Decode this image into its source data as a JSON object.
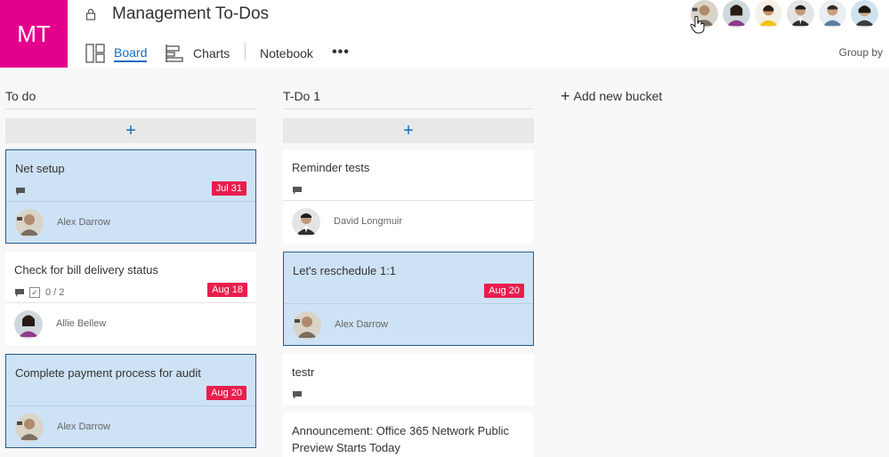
{
  "plan": {
    "initials": "MT",
    "logo_color": "#e3008c",
    "title": "Management To-Dos"
  },
  "nav": {
    "board": "Board",
    "charts": "Charts",
    "notebook": "Notebook",
    "more": "•••",
    "group_by": "Group by"
  },
  "members": [
    {
      "icon": "avatar-alex-darrow"
    },
    {
      "icon": "avatar-allie-bellew"
    },
    {
      "icon": "avatar-member-3"
    },
    {
      "icon": "avatar-david-longmuir"
    },
    {
      "icon": "avatar-member-5"
    },
    {
      "icon": "avatar-member-6"
    }
  ],
  "buckets": [
    {
      "name": "To do",
      "add_label": "+",
      "cards": [
        {
          "title": "Net setup",
          "due": "Jul 31",
          "assignee": "Alex Darrow",
          "selected": true
        },
        {
          "title": "Check for bill delivery status",
          "checklist": "0 / 2",
          "due": "Aug 18",
          "assignee": "Allie Bellew",
          "selected": false
        },
        {
          "title": "Complete payment process for audit",
          "due": "Aug 20",
          "assignee": "Alex Darrow",
          "selected": true
        }
      ]
    },
    {
      "name": "T-Do 1",
      "add_label": "+",
      "cards": [
        {
          "title": "Reminder tests",
          "assignee": "David Longmuir",
          "selected": false
        },
        {
          "title": "Let's reschedule 1:1",
          "due": "Aug 20",
          "assignee": "Alex Darrow",
          "selected": true
        },
        {
          "title": "testr",
          "selected": false
        },
        {
          "title": "Announcement: Office 365 Network Public Preview Starts Today",
          "selected": false
        }
      ]
    }
  ],
  "add_bucket": {
    "plus": "+",
    "label": "Add new bucket"
  },
  "colors": {
    "accent": "#106ebe",
    "due_badge": "#e81e4d",
    "selected_card": "#cde2f5"
  }
}
